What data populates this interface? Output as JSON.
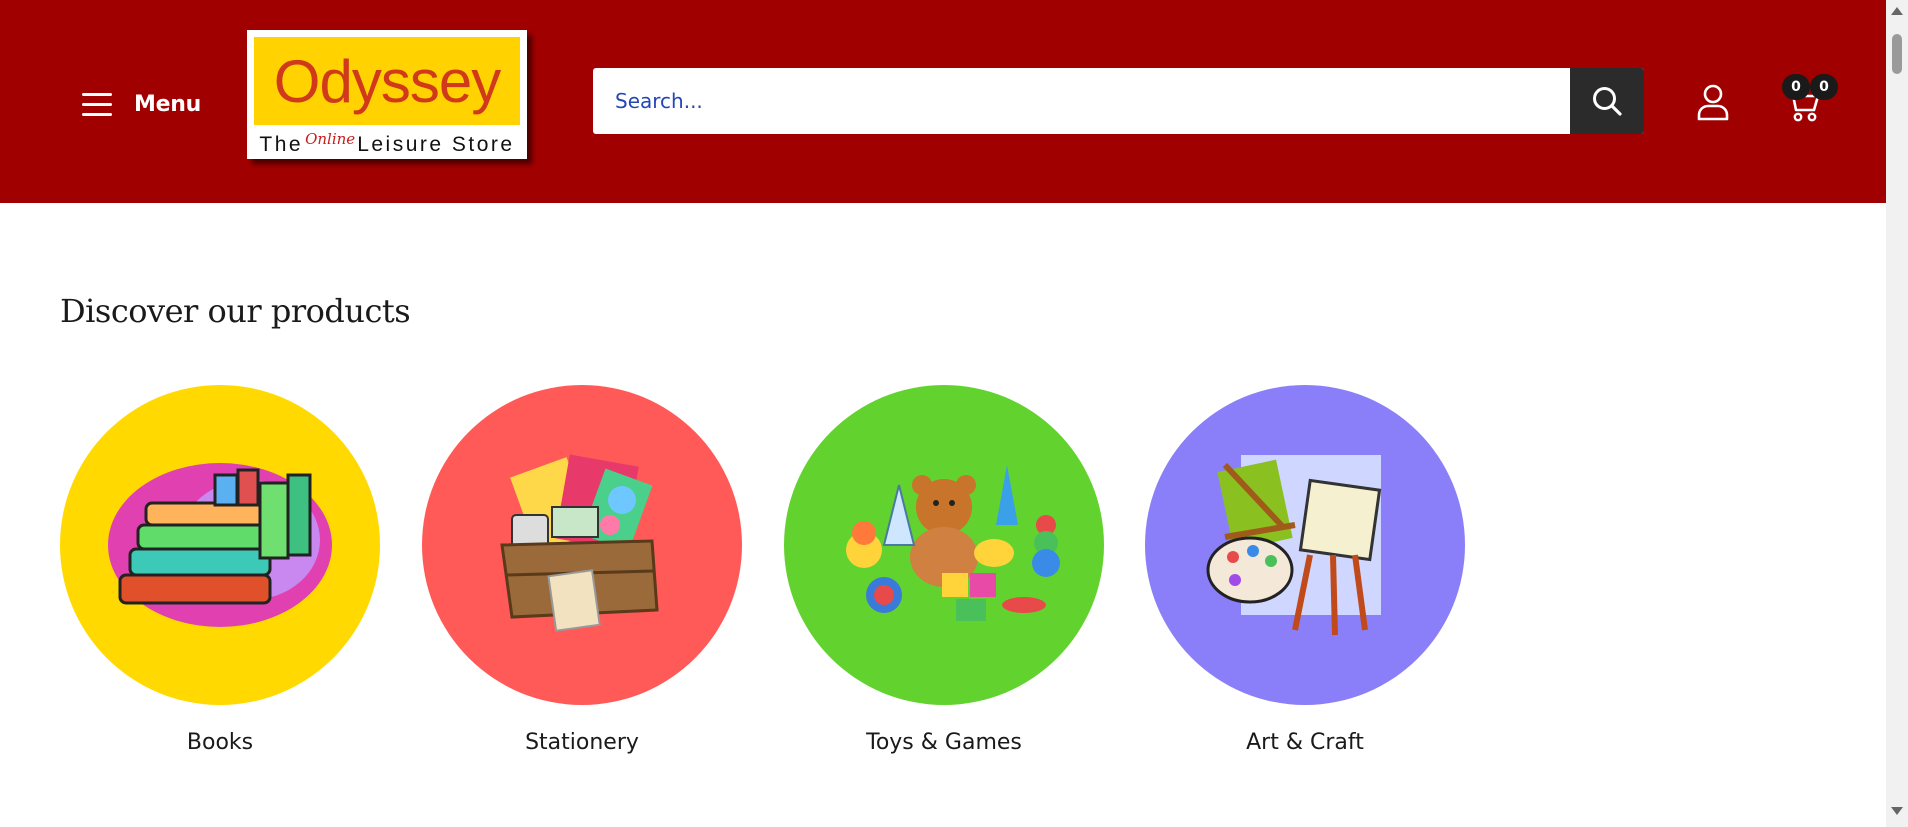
{
  "header": {
    "menu_label": "Menu",
    "logo": {
      "brand": "Odyssey",
      "tagline_left": "The",
      "tagline_mid": "Online",
      "tagline_right": "Leisure Store"
    },
    "search": {
      "placeholder": "Search..."
    },
    "cart_count": "0",
    "wishlist_count": "0",
    "colors": {
      "background": "#a10000",
      "search_button": "#2b2b2b",
      "logo_yellow": "#ffd200"
    }
  },
  "main": {
    "section_title": "Discover our products",
    "categories": [
      {
        "label": "Books",
        "color": "#ffd900",
        "icon": "books-icon"
      },
      {
        "label": "Stationery",
        "color": "#ff5a57",
        "icon": "stationery-box-icon"
      },
      {
        "label": "Toys & Games",
        "color": "#62d22f",
        "icon": "toys-icon"
      },
      {
        "label": "Art & Craft",
        "color": "#8a7ff8",
        "icon": "art-easel-icon"
      }
    ]
  }
}
